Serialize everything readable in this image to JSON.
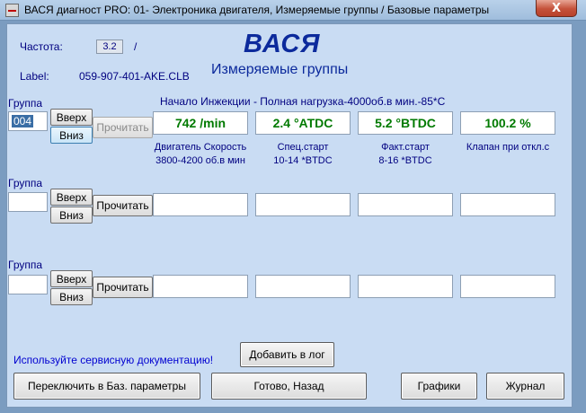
{
  "window": {
    "title": "ВАСЯ диагност PRO: 01- Электроника двигателя,  Измеряемые группы / Базовые параметры",
    "close_glyph": "X"
  },
  "header": {
    "freq_label": "Частота:",
    "freq_value": "3.2",
    "freq_sep": "/",
    "label_label": "Label:",
    "label_value": "059-907-401-AKE.CLB",
    "logo": "ВАСЯ",
    "subtitle": "Измеряемые группы"
  },
  "groups": [
    {
      "label": "Группа",
      "value": "004",
      "title": "Начало Инжекции - Полная нагрузка-4000об.в мин.-85*C",
      "up": "Вверх",
      "down": "Вниз",
      "read": "Прочитать",
      "values": [
        "742 /min",
        "2.4 °ATDC",
        "5.2 °BTDC",
        "100.2 %"
      ],
      "captions": [
        [
          "Двигатель Скорость",
          "3800-4200 об.в мин"
        ],
        [
          "Спец.старт",
          "10-14 *BTDC"
        ],
        [
          "Факт.старт",
          "8-16 *BTDC"
        ],
        [
          "Клапан при откл.с",
          ""
        ]
      ]
    },
    {
      "label": "Группа",
      "value": "",
      "up": "Вверх",
      "down": "Вниз",
      "read": "Прочитать"
    },
    {
      "label": "Группа",
      "value": "",
      "up": "Вверх",
      "down": "Вниз",
      "read": "Прочитать"
    }
  ],
  "footer": {
    "hint": "Используйте сервисную документацию!",
    "add_log": "Добавить в лог",
    "switch_basic": "Переключить в Баз. параметры",
    "done_back": "Готово, Назад",
    "graphs": "Графики",
    "journal": "Журнал"
  }
}
